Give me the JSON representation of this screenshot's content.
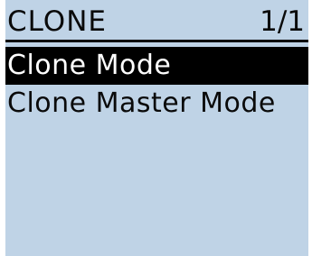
{
  "screen": {
    "title": "CLONE",
    "page_indicator": "1/1"
  },
  "menu": {
    "items": [
      {
        "label": "Clone Mode",
        "selected": true
      },
      {
        "label": "Clone Master Mode",
        "selected": false
      }
    ]
  },
  "colors": {
    "lcd_background": "#bfd3e6",
    "text": "#0a0a0a",
    "selection_background": "#000000",
    "selection_text": "#ffffff"
  }
}
